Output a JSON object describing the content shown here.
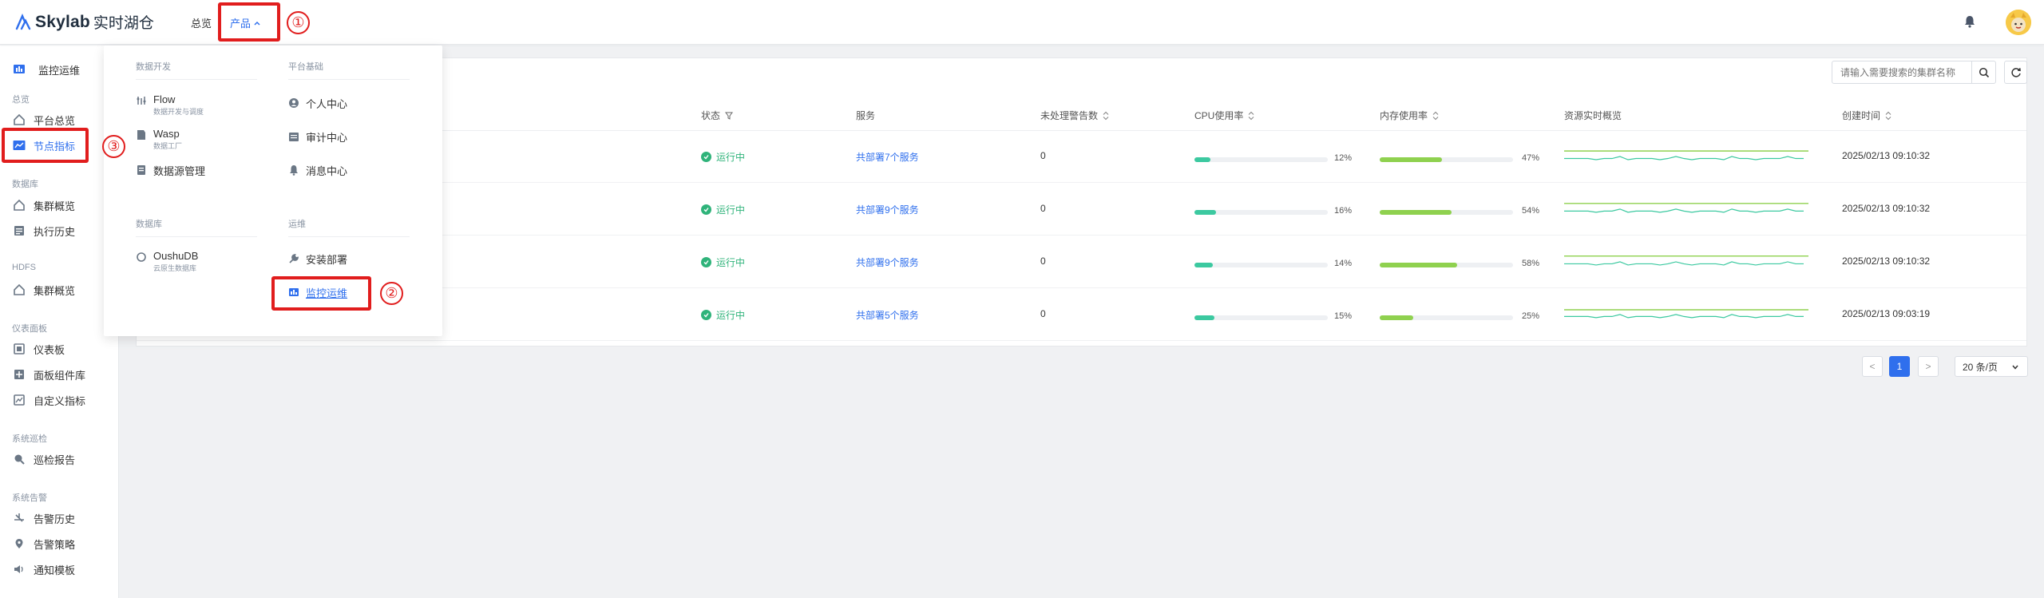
{
  "header": {
    "logo_text": "Skylab",
    "logo_sub": "实时湖仓",
    "nav_overview": "总览",
    "nav_product": "产品",
    "annotations": [
      "①",
      "②",
      "③"
    ]
  },
  "sidebar": {
    "top_item": "监控运维",
    "groups": [
      {
        "title": "总览",
        "items": [
          "平台总览",
          "节点指标"
        ]
      },
      {
        "title": "数据库",
        "items": [
          "集群概览",
          "执行历史"
        ]
      },
      {
        "title": "HDFS",
        "items": [
          "集群概览"
        ]
      },
      {
        "title": "仪表面板",
        "items": [
          "仪表板",
          "面板组件库",
          "自定义指标"
        ]
      },
      {
        "title": "系统巡检",
        "items": [
          "巡检报告"
        ]
      },
      {
        "title": "系统告警",
        "items": [
          "告警历史",
          "告警策略",
          "通知模板"
        ]
      }
    ],
    "active_item": "节点指标"
  },
  "dropdown": {
    "col1_group1": "数据开发",
    "col2_group1": "平台基础",
    "col1_group2": "数据库",
    "col2_group2": "运维",
    "flow_label": "Flow",
    "flow_sub": "数据开发与调度",
    "wasp_label": "Wasp",
    "wasp_sub": "数据工厂",
    "datasource_label": "数据源管理",
    "personal_label": "个人中心",
    "audit_label": "审计中心",
    "message_label": "消息中心",
    "oushu_label": "OushuDB",
    "oushu_sub": "云原生数据库",
    "install_label": "安装部署",
    "monitor_label": "监控运维"
  },
  "search": {
    "placeholder": "请输入需要搜索的集群名称"
  },
  "table": {
    "columns": {
      "status": "状态",
      "service": "服务",
      "alerts": "未处理警告数",
      "cpu": "CPU使用率",
      "mem": "内存使用率",
      "resource": "资源实时概览",
      "created": "创建时间"
    },
    "rows": [
      {
        "status": "运行中",
        "service": "共部署7个服务",
        "alerts": "0",
        "cpu": 12,
        "cpu_label": "12%",
        "mem": 47,
        "mem_label": "47%",
        "created": "2025/02/13 09:10:32"
      },
      {
        "status": "运行中",
        "service": "共部署9个服务",
        "alerts": "0",
        "cpu": 16,
        "cpu_label": "16%",
        "mem": 54,
        "mem_label": "54%",
        "created": "2025/02/13 09:10:32"
      },
      {
        "status": "运行中",
        "service": "共部署9个服务",
        "alerts": "0",
        "cpu": 14,
        "cpu_label": "14%",
        "mem": 58,
        "mem_label": "58%",
        "created": "2025/02/13 09:10:32"
      },
      {
        "status": "运行中",
        "service": "共部署5个服务",
        "alerts": "0",
        "cpu": 15,
        "cpu_label": "15%",
        "mem": 25,
        "mem_label": "25%",
        "created": "2025/02/13 09:03:19"
      }
    ]
  },
  "pagination": {
    "prev": "<",
    "current": "1",
    "next": ">",
    "page_size": "20 条/页"
  },
  "colors": {
    "accent": "#2f6fed",
    "running": "#2fb37a",
    "cpu_bar": "#3cc9a0",
    "mem_bar": "#8fd14f",
    "highlight": "#e11d1d"
  }
}
